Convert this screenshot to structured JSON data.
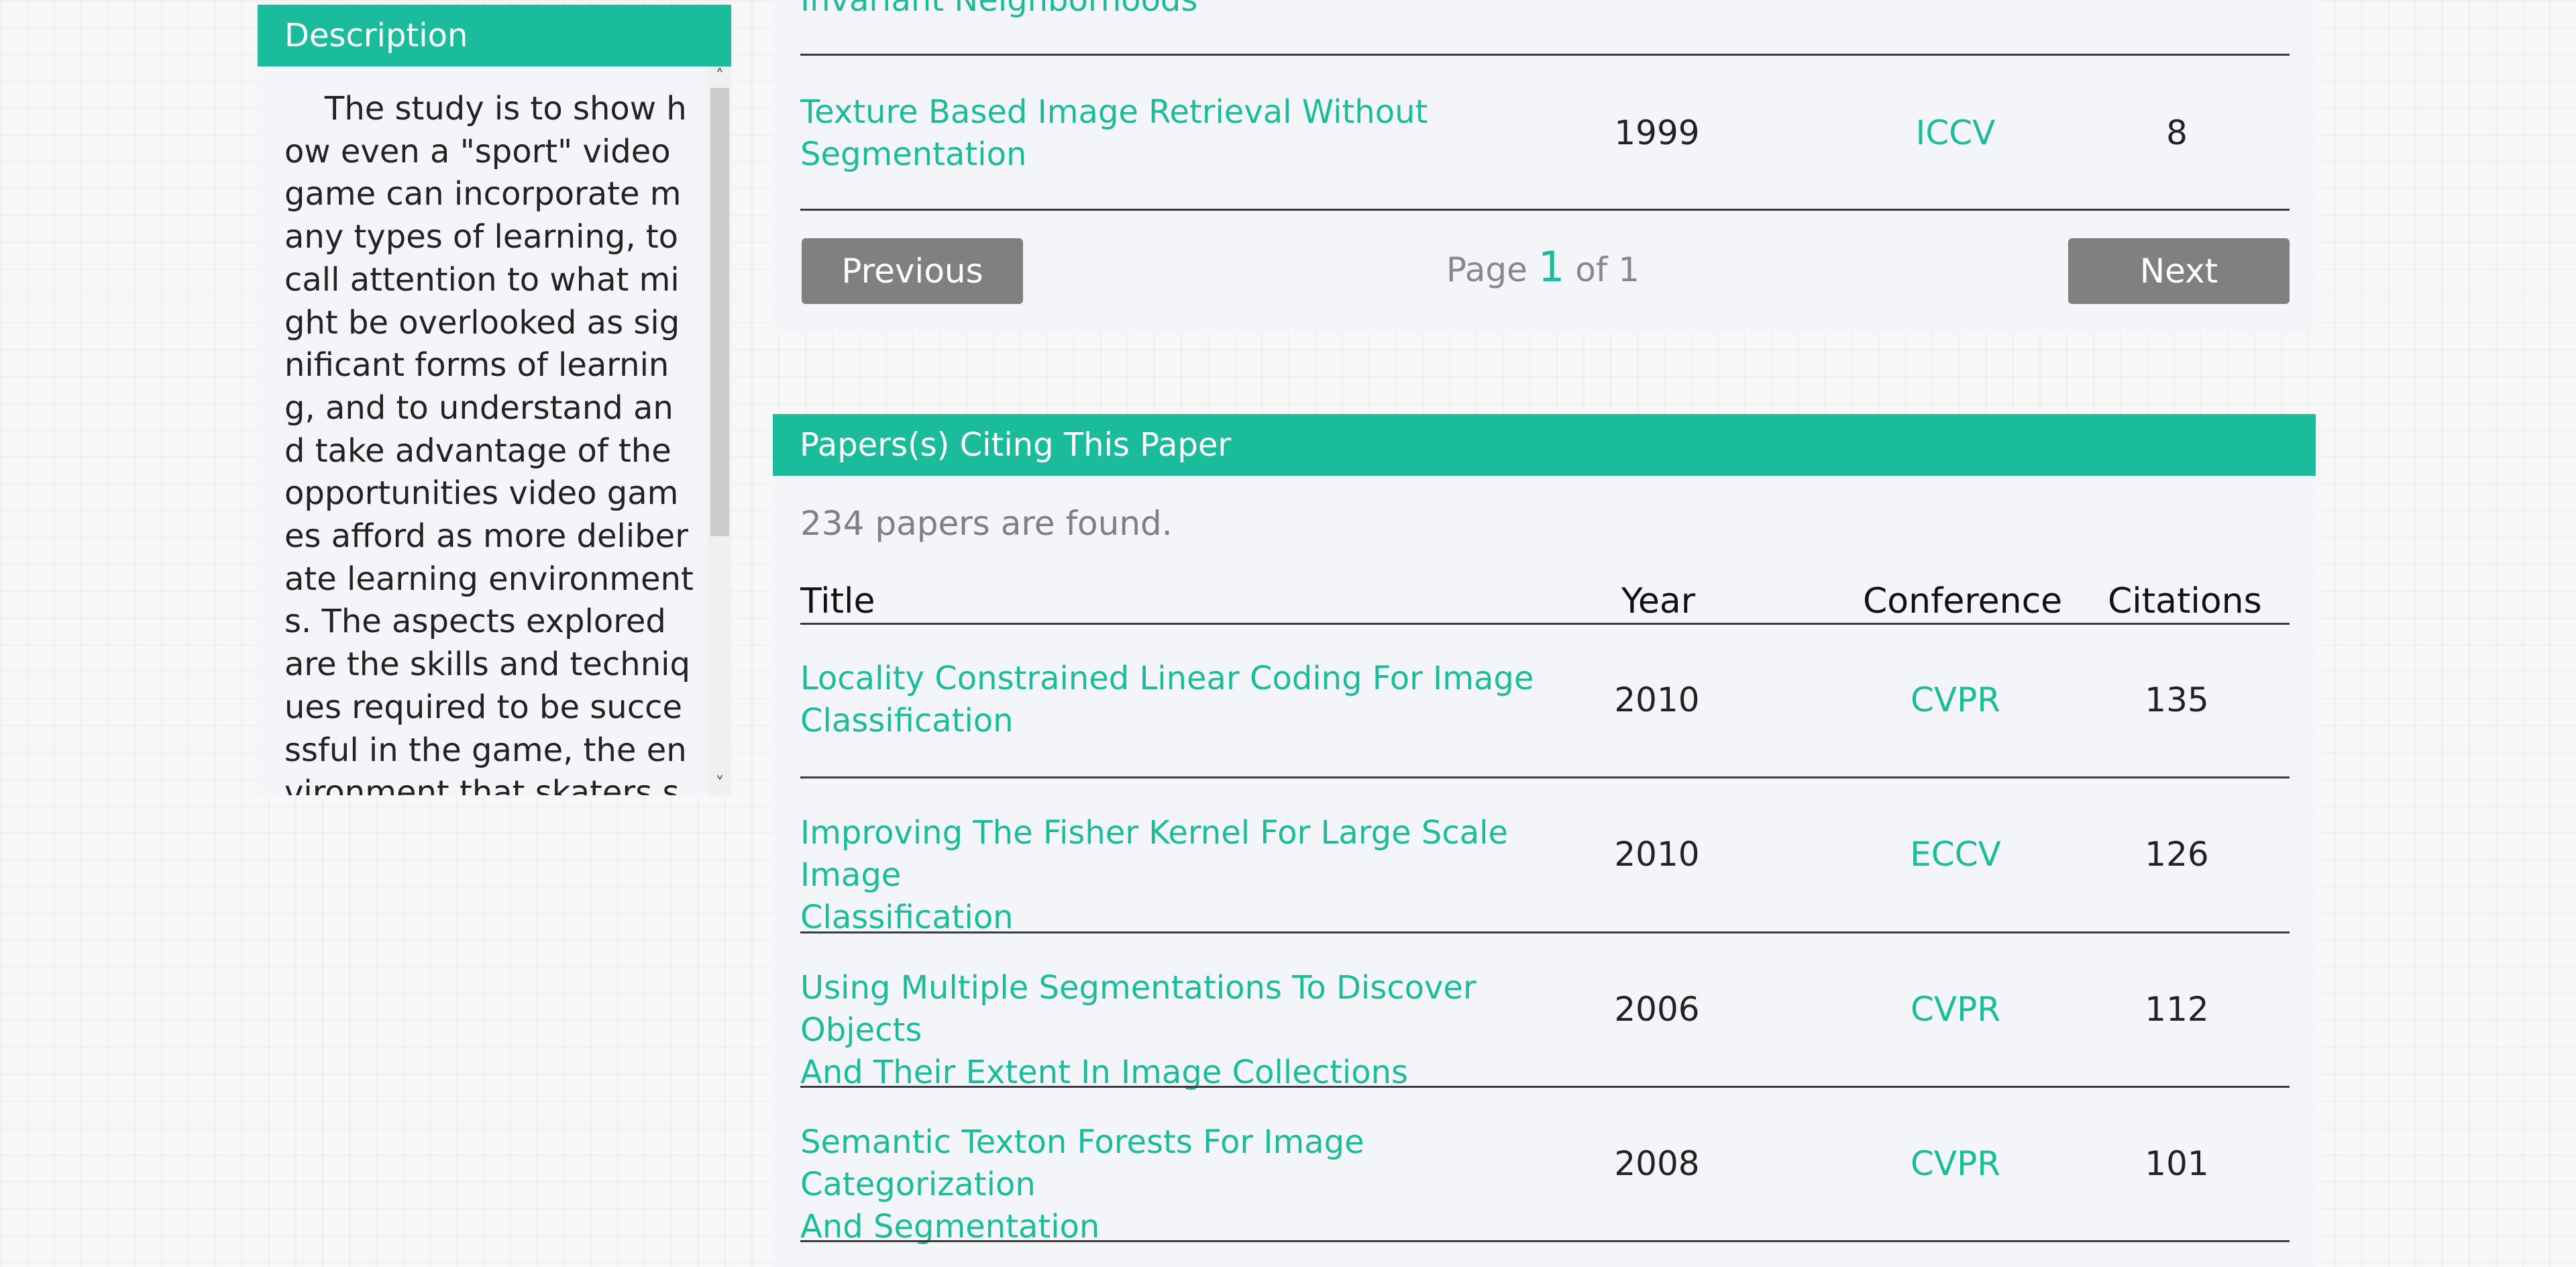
{
  "description": {
    "header": "Description",
    "text": "The study is to show how even a \"sport\" video game can incorporate many types of learning, to call attention to what might be overlooked as significant forms of learning, and to understand and take advantage of the opportunities video games afford as more deliberate learning environments. The aspects explored are the skills and techniques required to be successful in the game, the environment that skaters skate in",
    "scroll_up_glyph": "˄",
    "scroll_down_glyph": "˅"
  },
  "references": {
    "partial_title": "Invariant Neighborhoods",
    "rows": [
      {
        "title_line1": "Texture Based Image Retrieval Without",
        "title_line2": "Segmentation",
        "year": "1999",
        "conference": "ICCV",
        "citations": "8"
      }
    ],
    "pager": {
      "previous_label": "Previous",
      "next_label": "Next",
      "page_prefix": "Page",
      "current_page": "1",
      "page_suffix": "of 1"
    }
  },
  "citing": {
    "header": "Papers(s) Citing This Paper",
    "count_text": "234 papers are found.",
    "columns": {
      "title": "Title",
      "year": "Year",
      "conference": "Conference",
      "citations": "Citations"
    },
    "rows": [
      {
        "title_line1": "Locality Constrained Linear Coding For Image",
        "title_line2": "Classification",
        "year": "2010",
        "conference": "CVPR",
        "citations": "135"
      },
      {
        "title_line1": "Improving The Fisher Kernel For Large Scale Image",
        "title_line2": "Classification",
        "year": "2010",
        "conference": "ECCV",
        "citations": "126"
      },
      {
        "title_line1": "Using Multiple Segmentations To Discover Objects",
        "title_line2": "And Their Extent In Image Collections",
        "year": "2006",
        "conference": "CVPR",
        "citations": "112"
      },
      {
        "title_line1": "Semantic Texton Forests For Image Categorization",
        "title_line2": "And Segmentation",
        "year": "2008",
        "conference": "CVPR",
        "citations": "101"
      }
    ]
  },
  "colors": {
    "accent": "#1bbc9b",
    "button": "#808080",
    "card": "#f4f5f8"
  }
}
